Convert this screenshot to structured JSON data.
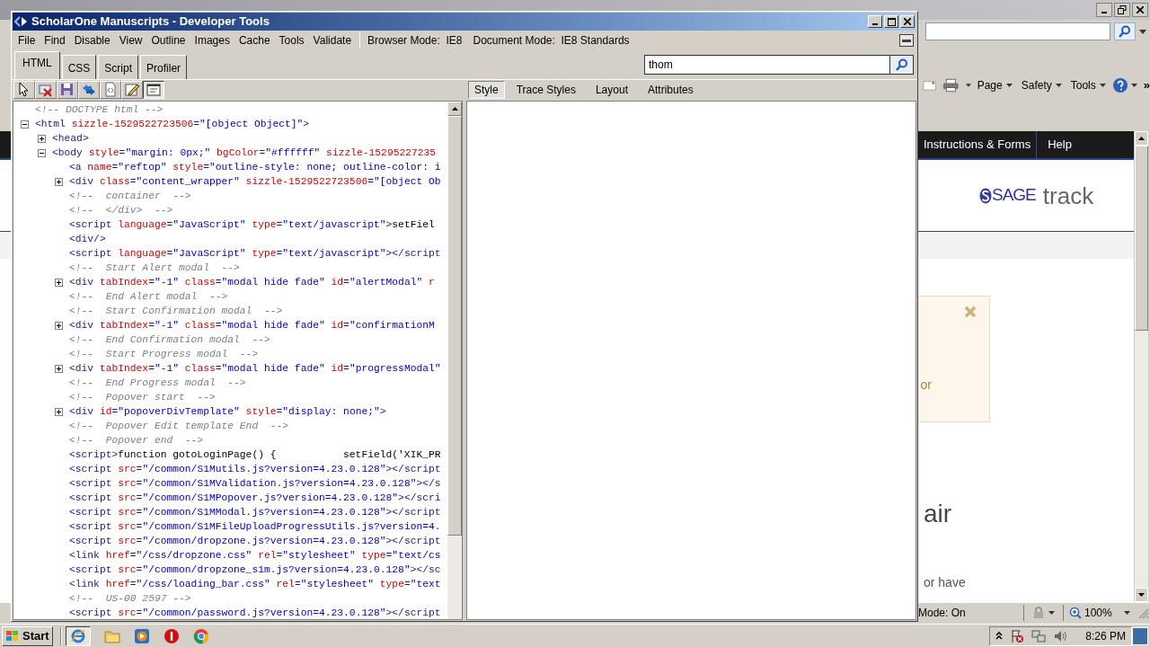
{
  "browser_window": {
    "command_bar": {
      "menus": [
        "Page",
        "Safety",
        "Tools"
      ],
      "more": "»"
    },
    "page": {
      "nav_links": [
        "Instructions & Forms",
        "Help"
      ],
      "logo": {
        "brand": "SAGE",
        "product": "track"
      },
      "alert": {
        "text": "or"
      },
      "heading": "air",
      "body_text": "or have"
    },
    "status_bar": {
      "protected_mode": "Mode: On",
      "zoom": "100%"
    }
  },
  "devtools": {
    "title": "ScholarOne Manuscripts - Developer Tools",
    "menu": [
      "File",
      "Find",
      "Disable",
      "View",
      "Outline",
      "Images",
      "Cache",
      "Tools",
      "Validate"
    ],
    "modes": [
      "Browser Mode:  IE8",
      "Document Mode:  IE8 Standards"
    ],
    "tabs": [
      {
        "label": "HTML",
        "selected": true
      },
      {
        "label": "CSS",
        "selected": false
      },
      {
        "label": "Script",
        "selected": false
      },
      {
        "label": "Profiler",
        "selected": false
      }
    ],
    "search": {
      "value": "thom"
    },
    "toolbar": [
      {
        "kind": "select",
        "pressed": false
      },
      {
        "kind": "clear",
        "pressed": false
      },
      {
        "kind": "save",
        "pressed": false
      },
      {
        "kind": "refresh",
        "pressed": false
      },
      {
        "kind": "source",
        "pressed": false
      },
      {
        "kind": "edit",
        "pressed": false
      },
      {
        "kind": "wrap",
        "pressed": true
      }
    ],
    "side_tabs": [
      {
        "label": "Style",
        "selected": true
      },
      {
        "label": "Trace Styles",
        "selected": false
      },
      {
        "label": "Layout",
        "selected": false
      },
      {
        "label": "Attributes",
        "selected": false
      }
    ],
    "tree": [
      {
        "kind": "leaf",
        "tokens": [
          {
            "kind": "comment",
            "text": "<!-- DOCTYPE html -->"
          }
        ]
      },
      {
        "kind": "node",
        "expanded": true,
        "tokens": [
          {
            "kind": "tag",
            "text": "<html"
          },
          {
            "kind": "attr",
            "text": " sizzle-1529522723506"
          },
          {
            "kind": "tag",
            "text": "="
          },
          {
            "kind": "value",
            "text": "\"[object Object]\""
          },
          {
            "kind": "tag",
            "text": ">"
          }
        ],
        "children": [
          {
            "kind": "node",
            "expanded": false,
            "tokens": [
              {
                "kind": "tag",
                "text": "<head>"
              }
            ]
          },
          {
            "kind": "node",
            "expanded": true,
            "tokens": [
              {
                "kind": "tag",
                "text": "<body"
              },
              {
                "kind": "attr",
                "text": " style"
              },
              {
                "kind": "tag",
                "text": "="
              },
              {
                "kind": "value",
                "text": "\"margin: 0px;\""
              },
              {
                "kind": "attr",
                "text": " bgColor"
              },
              {
                "kind": "tag",
                "text": "="
              },
              {
                "kind": "value",
                "text": "\"#ffffff\""
              },
              {
                "kind": "attr",
                "text": " sizzle-15295227235"
              }
            ],
            "children": [
              {
                "kind": "leaf",
                "tokens": [
                  {
                    "kind": "tag",
                    "text": "<a"
                  },
                  {
                    "kind": "attr",
                    "text": " name"
                  },
                  {
                    "kind": "tag",
                    "text": "="
                  },
                  {
                    "kind": "value",
                    "text": "\"reftop\""
                  },
                  {
                    "kind": "attr",
                    "text": " style"
                  },
                  {
                    "kind": "tag",
                    "text": "="
                  },
                  {
                    "kind": "value",
                    "text": "\"outline-style: none; outline-color: i"
                  }
                ]
              },
              {
                "kind": "node",
                "expanded": false,
                "tokens": [
                  {
                    "kind": "tag",
                    "text": "<div"
                  },
                  {
                    "kind": "attr",
                    "text": " class"
                  },
                  {
                    "kind": "tag",
                    "text": "="
                  },
                  {
                    "kind": "value",
                    "text": "\"content_wrapper\""
                  },
                  {
                    "kind": "attr",
                    "text": " sizzle-1529522723506"
                  },
                  {
                    "kind": "tag",
                    "text": "="
                  },
                  {
                    "kind": "value",
                    "text": "\"[object Ob"
                  }
                ]
              },
              {
                "kind": "leaf",
                "tokens": [
                  {
                    "kind": "comment",
                    "text": "<!--  container  -->"
                  }
                ]
              },
              {
                "kind": "leaf",
                "tokens": [
                  {
                    "kind": "comment",
                    "text": "<!--  </div>  -->"
                  }
                ]
              },
              {
                "kind": "leaf",
                "tokens": [
                  {
                    "kind": "tag",
                    "text": "<script"
                  },
                  {
                    "kind": "attr",
                    "text": " language"
                  },
                  {
                    "kind": "tag",
                    "text": "="
                  },
                  {
                    "kind": "value",
                    "text": "\"JavaScript\""
                  },
                  {
                    "kind": "attr",
                    "text": " type"
                  },
                  {
                    "kind": "tag",
                    "text": "="
                  },
                  {
                    "kind": "value",
                    "text": "\"text/javascript\""
                  },
                  {
                    "kind": "tag",
                    "text": ">"
                  },
                  {
                    "kind": "text",
                    "text": "setFiel"
                  }
                ]
              },
              {
                "kind": "leaf",
                "tokens": [
                  {
                    "kind": "tag",
                    "text": "<div/>"
                  }
                ]
              },
              {
                "kind": "leaf",
                "tokens": [
                  {
                    "kind": "tag",
                    "text": "<script"
                  },
                  {
                    "kind": "attr",
                    "text": " language"
                  },
                  {
                    "kind": "tag",
                    "text": "="
                  },
                  {
                    "kind": "value",
                    "text": "\"JavaScript\""
                  },
                  {
                    "kind": "attr",
                    "text": " type"
                  },
                  {
                    "kind": "tag",
                    "text": "="
                  },
                  {
                    "kind": "value",
                    "text": "\"text/javascript\""
                  },
                  {
                    "kind": "tag",
                    "text": "></script"
                  }
                ]
              },
              {
                "kind": "leaf",
                "tokens": [
                  {
                    "kind": "comment",
                    "text": "<!--  Start Alert modal  -->"
                  }
                ]
              },
              {
                "kind": "node",
                "expanded": false,
                "tokens": [
                  {
                    "kind": "tag",
                    "text": "<div"
                  },
                  {
                    "kind": "attr",
                    "text": " tabIndex"
                  },
                  {
                    "kind": "tag",
                    "text": "="
                  },
                  {
                    "kind": "value",
                    "text": "\"-1\""
                  },
                  {
                    "kind": "attr",
                    "text": " class"
                  },
                  {
                    "kind": "tag",
                    "text": "="
                  },
                  {
                    "kind": "value",
                    "text": "\"modal hide fade\""
                  },
                  {
                    "kind": "attr",
                    "text": " id"
                  },
                  {
                    "kind": "tag",
                    "text": "="
                  },
                  {
                    "kind": "value",
                    "text": "\"alertModal\""
                  },
                  {
                    "kind": "attr",
                    "text": " r"
                  }
                ]
              },
              {
                "kind": "leaf",
                "tokens": [
                  {
                    "kind": "comment",
                    "text": "<!--  End Alert modal  -->"
                  }
                ]
              },
              {
                "kind": "leaf",
                "tokens": [
                  {
                    "kind": "comment",
                    "text": "<!--  Start Confirmation modal  -->"
                  }
                ]
              },
              {
                "kind": "node",
                "expanded": false,
                "tokens": [
                  {
                    "kind": "tag",
                    "text": "<div"
                  },
                  {
                    "kind": "attr",
                    "text": " tabIndex"
                  },
                  {
                    "kind": "tag",
                    "text": "="
                  },
                  {
                    "kind": "value",
                    "text": "\"-1\""
                  },
                  {
                    "kind": "attr",
                    "text": " class"
                  },
                  {
                    "kind": "tag",
                    "text": "="
                  },
                  {
                    "kind": "value",
                    "text": "\"modal hide fade\""
                  },
                  {
                    "kind": "attr",
                    "text": " id"
                  },
                  {
                    "kind": "tag",
                    "text": "="
                  },
                  {
                    "kind": "value",
                    "text": "\"confirmationM"
                  }
                ]
              },
              {
                "kind": "leaf",
                "tokens": [
                  {
                    "kind": "comment",
                    "text": "<!--  End Confirmation modal  -->"
                  }
                ]
              },
              {
                "kind": "leaf",
                "tokens": [
                  {
                    "kind": "comment",
                    "text": "<!--  Start Progress modal  -->"
                  }
                ]
              },
              {
                "kind": "node",
                "expanded": false,
                "tokens": [
                  {
                    "kind": "tag",
                    "text": "<div"
                  },
                  {
                    "kind": "attr",
                    "text": " tabIndex"
                  },
                  {
                    "kind": "tag",
                    "text": "="
                  },
                  {
                    "kind": "value",
                    "text": "\"-1\""
                  },
                  {
                    "kind": "attr",
                    "text": " class"
                  },
                  {
                    "kind": "tag",
                    "text": "="
                  },
                  {
                    "kind": "value",
                    "text": "\"modal hide fade\""
                  },
                  {
                    "kind": "attr",
                    "text": " id"
                  },
                  {
                    "kind": "tag",
                    "text": "="
                  },
                  {
                    "kind": "value",
                    "text": "\"progressModal\""
                  }
                ]
              },
              {
                "kind": "leaf",
                "tokens": [
                  {
                    "kind": "comment",
                    "text": "<!--  End Progress modal  -->"
                  }
                ]
              },
              {
                "kind": "leaf",
                "tokens": [
                  {
                    "kind": "comment",
                    "text": "<!--  Popover start  -->"
                  }
                ]
              },
              {
                "kind": "node",
                "expanded": false,
                "tokens": [
                  {
                    "kind": "tag",
                    "text": "<div"
                  },
                  {
                    "kind": "attr",
                    "text": " id"
                  },
                  {
                    "kind": "tag",
                    "text": "="
                  },
                  {
                    "kind": "value",
                    "text": "\"popoverDivTemplate\""
                  },
                  {
                    "kind": "attr",
                    "text": " style"
                  },
                  {
                    "kind": "tag",
                    "text": "="
                  },
                  {
                    "kind": "value",
                    "text": "\"display: none;\""
                  },
                  {
                    "kind": "tag",
                    "text": ">"
                  }
                ]
              },
              {
                "kind": "leaf",
                "tokens": [
                  {
                    "kind": "comment",
                    "text": "<!--  Popover Edit template End  -->"
                  }
                ]
              },
              {
                "kind": "leaf",
                "tokens": [
                  {
                    "kind": "comment",
                    "text": "<!--  Popover end  -->"
                  }
                ]
              },
              {
                "kind": "leaf",
                "tokens": [
                  {
                    "kind": "tag",
                    "text": "<script>"
                  },
                  {
                    "kind": "text",
                    "text": "function gotoLoginPage() {           setField('XIK_PR"
                  }
                ]
              },
              {
                "kind": "leaf",
                "tokens": [
                  {
                    "kind": "tag",
                    "text": "<script"
                  },
                  {
                    "kind": "attr",
                    "text": " src"
                  },
                  {
                    "kind": "tag",
                    "text": "="
                  },
                  {
                    "kind": "value",
                    "text": "\"/common/S1Mutils.js?version=4.23.0.128\""
                  },
                  {
                    "kind": "tag",
                    "text": "></script"
                  }
                ]
              },
              {
                "kind": "leaf",
                "tokens": [
                  {
                    "kind": "tag",
                    "text": "<script"
                  },
                  {
                    "kind": "attr",
                    "text": " src"
                  },
                  {
                    "kind": "tag",
                    "text": "="
                  },
                  {
                    "kind": "value",
                    "text": "\"/common/S1MValidation.js?version=4.23.0.128\""
                  },
                  {
                    "kind": "tag",
                    "text": "></s"
                  }
                ]
              },
              {
                "kind": "leaf",
                "tokens": [
                  {
                    "kind": "tag",
                    "text": "<script"
                  },
                  {
                    "kind": "attr",
                    "text": " src"
                  },
                  {
                    "kind": "tag",
                    "text": "="
                  },
                  {
                    "kind": "value",
                    "text": "\"/common/S1MPopover.js?version=4.23.0.128\""
                  },
                  {
                    "kind": "tag",
                    "text": "></scri"
                  }
                ]
              },
              {
                "kind": "leaf",
                "tokens": [
                  {
                    "kind": "tag",
                    "text": "<script"
                  },
                  {
                    "kind": "attr",
                    "text": " src"
                  },
                  {
                    "kind": "tag",
                    "text": "="
                  },
                  {
                    "kind": "value",
                    "text": "\"/common/S1MModal.js?version=4.23.0.128\""
                  },
                  {
                    "kind": "tag",
                    "text": "></script"
                  }
                ]
              },
              {
                "kind": "leaf",
                "tokens": [
                  {
                    "kind": "tag",
                    "text": "<script"
                  },
                  {
                    "kind": "attr",
                    "text": " src"
                  },
                  {
                    "kind": "tag",
                    "text": "="
                  },
                  {
                    "kind": "value",
                    "text": "\"/common/S1MFileUploadProgressUtils.js?version=4."
                  }
                ]
              },
              {
                "kind": "leaf",
                "tokens": [
                  {
                    "kind": "tag",
                    "text": "<script"
                  },
                  {
                    "kind": "attr",
                    "text": " src"
                  },
                  {
                    "kind": "tag",
                    "text": "="
                  },
                  {
                    "kind": "value",
                    "text": "\"/common/dropzone.js?version=4.23.0.128\""
                  },
                  {
                    "kind": "tag",
                    "text": "></script"
                  }
                ]
              },
              {
                "kind": "leaf",
                "tokens": [
                  {
                    "kind": "tag",
                    "text": "<link"
                  },
                  {
                    "kind": "attr",
                    "text": " href"
                  },
                  {
                    "kind": "tag",
                    "text": "="
                  },
                  {
                    "kind": "value",
                    "text": "\"/css/dropzone.css\""
                  },
                  {
                    "kind": "attr",
                    "text": " rel"
                  },
                  {
                    "kind": "tag",
                    "text": "="
                  },
                  {
                    "kind": "value",
                    "text": "\"stylesheet\""
                  },
                  {
                    "kind": "attr",
                    "text": " type"
                  },
                  {
                    "kind": "tag",
                    "text": "="
                  },
                  {
                    "kind": "value",
                    "text": "\"text/cs"
                  }
                ]
              },
              {
                "kind": "leaf",
                "tokens": [
                  {
                    "kind": "tag",
                    "text": "<script"
                  },
                  {
                    "kind": "attr",
                    "text": " src"
                  },
                  {
                    "kind": "tag",
                    "text": "="
                  },
                  {
                    "kind": "value",
                    "text": "\"/common/dropzone_s1m.js?version=4.23.0.128\""
                  },
                  {
                    "kind": "tag",
                    "text": "></sc"
                  }
                ]
              },
              {
                "kind": "leaf",
                "tokens": [
                  {
                    "kind": "tag",
                    "text": "<link"
                  },
                  {
                    "kind": "attr",
                    "text": " href"
                  },
                  {
                    "kind": "tag",
                    "text": "="
                  },
                  {
                    "kind": "value",
                    "text": "\"/css/loading_bar.css\""
                  },
                  {
                    "kind": "attr",
                    "text": " rel"
                  },
                  {
                    "kind": "tag",
                    "text": "="
                  },
                  {
                    "kind": "value",
                    "text": "\"stylesheet\""
                  },
                  {
                    "kind": "attr",
                    "text": " type"
                  },
                  {
                    "kind": "tag",
                    "text": "="
                  },
                  {
                    "kind": "value",
                    "text": "\"text"
                  }
                ]
              },
              {
                "kind": "leaf",
                "tokens": [
                  {
                    "kind": "comment",
                    "text": "<!--  US-00 2597 -->"
                  }
                ]
              },
              {
                "kind": "leaf",
                "tokens": [
                  {
                    "kind": "tag",
                    "text": "<script"
                  },
                  {
                    "kind": "attr",
                    "text": " src"
                  },
                  {
                    "kind": "tag",
                    "text": "="
                  },
                  {
                    "kind": "value",
                    "text": "\"/common/password.js?version=4.23.0.128\""
                  },
                  {
                    "kind": "tag",
                    "text": "></script"
                  }
                ]
              }
            ]
          }
        ]
      }
    ]
  },
  "taskbar": {
    "start": "Start",
    "clock": "8:26 PM"
  }
}
